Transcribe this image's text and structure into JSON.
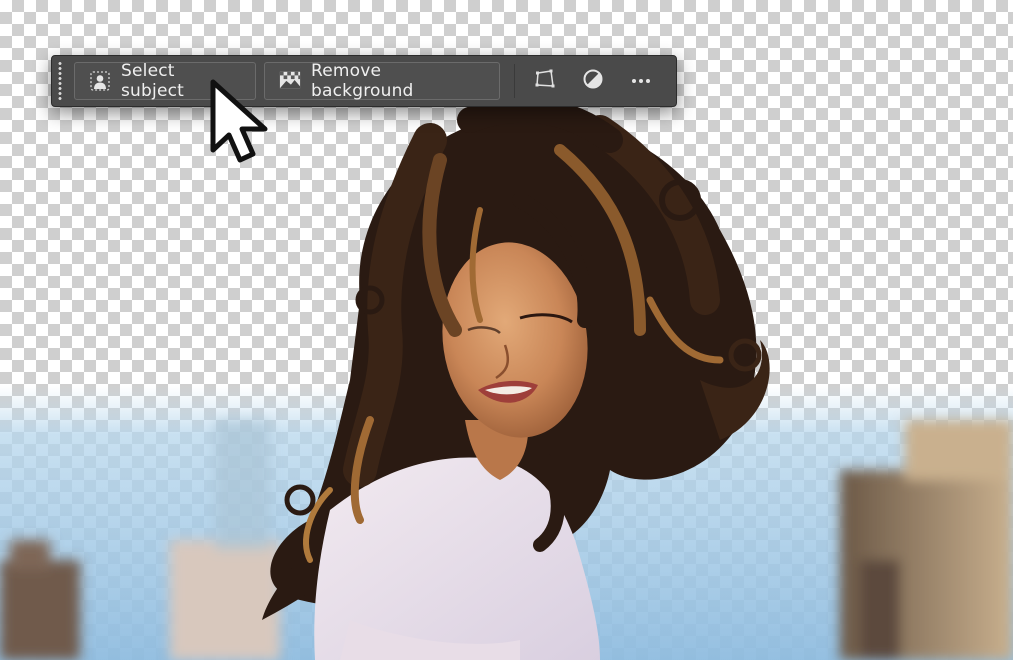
{
  "taskbar": {
    "select_subject_label": "Select subject",
    "remove_background_label": "Remove background",
    "icons": {
      "select_subject": "person-silhouette-icon",
      "remove_background": "image-checkerboard-icon",
      "transform": "transform-warp-icon",
      "adjust": "contrast-circle-icon",
      "more": "more-options-icon"
    }
  },
  "colors": {
    "taskbar_bg": "#4a4a4a",
    "button_border": "#6b6b6b",
    "label_text": "#efefef",
    "sky": "#a9cde6",
    "hair": "#3a2416"
  },
  "canvas": {
    "background_pattern": "transparency-checkerboard",
    "subject": "woman-with-curly-hair"
  }
}
